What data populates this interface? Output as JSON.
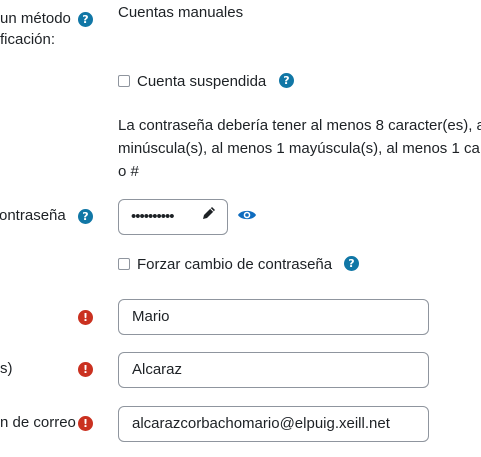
{
  "auth": {
    "label_line1": "un método",
    "label_line2": "ficación:",
    "value": "Cuentas manuales"
  },
  "suspended": {
    "label": "Cuenta suspendida"
  },
  "password_policy": {
    "line1": "La contraseña debería tener al menos 8 caracter(es), a",
    "line2": "minúscula(s), al menos 1 mayúscula(s), al menos 1 ca",
    "line3": "o #"
  },
  "password": {
    "label": "ontraseña",
    "masked_value": "••••••••••"
  },
  "force_change": {
    "label": "Forzar cambio de contraseña"
  },
  "firstname": {
    "label": "",
    "value": "Mario"
  },
  "lastname": {
    "label": "s)",
    "value": "Alcaraz"
  },
  "email": {
    "label": "n de correo",
    "value": "alcarazcorbachomario@elpuig.xeill.net"
  },
  "icons": {
    "help": "help-icon",
    "error": "error-icon",
    "edit": "pencil-icon",
    "reveal": "eye-icon"
  },
  "colors": {
    "help": "#1177a6",
    "error": "#ca3120",
    "reveal": "#0f6cbf"
  }
}
